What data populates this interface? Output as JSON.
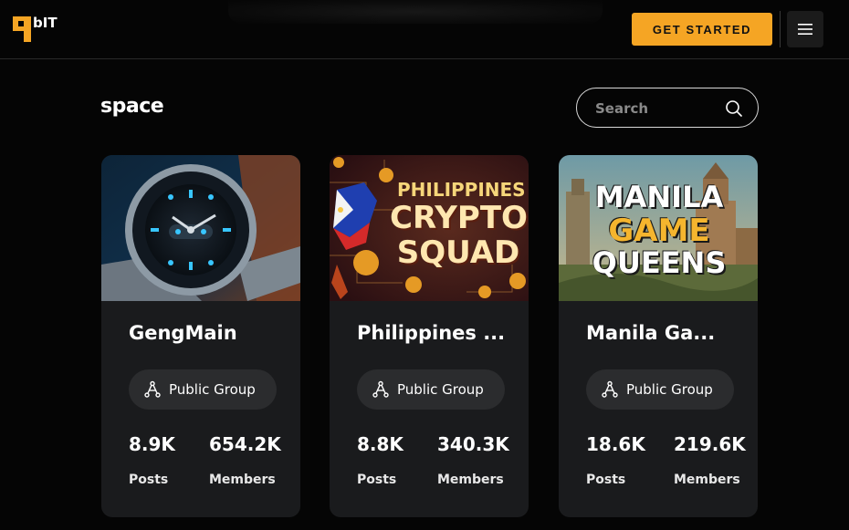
{
  "header": {
    "logo_text": "bIT",
    "cta_label": "GET STARTED",
    "menu_icon": "hamburger-icon"
  },
  "page": {
    "title": "space"
  },
  "search": {
    "placeholder": "Search",
    "icon": "search-icon"
  },
  "colors": {
    "accent": "#f5a524",
    "background": "#050505",
    "card": "#1a1b1d",
    "pill": "#2b2c2e"
  },
  "cards": [
    {
      "title": "GengMain",
      "group_label": "Public Group",
      "group_icon": "group-tree-icon",
      "posts_value": "8.9K",
      "posts_label": "Posts",
      "members_value": "654.2K",
      "members_label": "Members"
    },
    {
      "title": "Philippines ...",
      "image_text": [
        "PHILIPPINES",
        "CRYPTO",
        "SQUAD"
      ],
      "group_label": "Public Group",
      "group_icon": "group-tree-icon",
      "posts_value": "8.8K",
      "posts_label": "Posts",
      "members_value": "340.3K",
      "members_label": "Members"
    },
    {
      "title": "Manila Ga...",
      "image_text": [
        "MANILA",
        "GAME",
        "QUEENS"
      ],
      "group_label": "Public Group",
      "group_icon": "group-tree-icon",
      "posts_value": "18.6K",
      "posts_label": "Posts",
      "members_value": "219.6K",
      "members_label": "Members"
    }
  ]
}
